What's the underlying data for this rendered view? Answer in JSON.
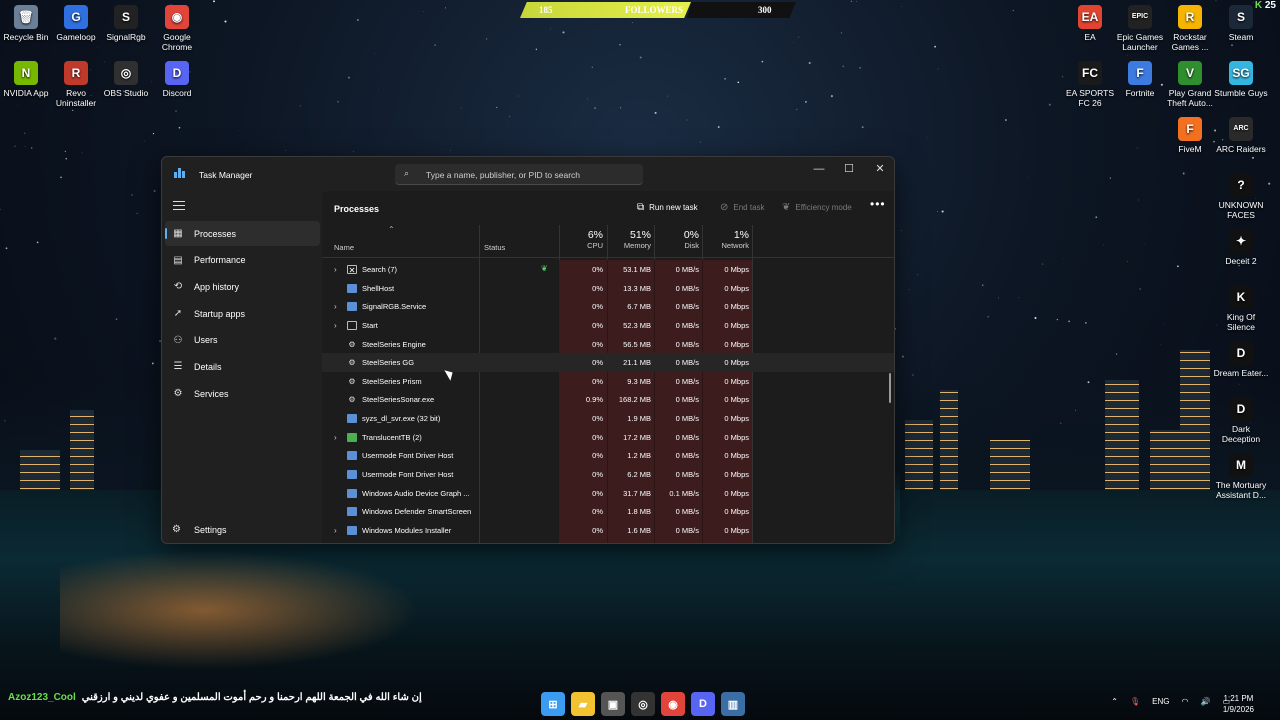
{
  "desktop": {
    "left_icons": [
      {
        "label": "Recycle Bin",
        "icon": "recycle-bin-icon",
        "color": "#6b7f96",
        "glyph": "🗑"
      },
      {
        "label": "Gameloop",
        "icon": "gameloop-icon",
        "color": "#2f6fe0",
        "glyph": "G"
      },
      {
        "label": "SignalRgb",
        "icon": "signalrgb-icon",
        "color": "#222222",
        "glyph": "S"
      },
      {
        "label": "Google Chrome",
        "icon": "chrome-icon",
        "color": "#e0443a",
        "glyph": "◉"
      },
      {
        "label": "NVIDIA App",
        "icon": "nvidia-icon",
        "color": "#76b900",
        "glyph": "N"
      },
      {
        "label": "Revo Uninstaller",
        "icon": "revo-icon",
        "color": "#c0392b",
        "glyph": "R"
      },
      {
        "label": "OBS Studio",
        "icon": "obs-icon",
        "color": "#303030",
        "glyph": "◎"
      },
      {
        "label": "Discord",
        "icon": "discord-icon",
        "color": "#5865f2",
        "glyph": "D"
      }
    ],
    "right_icons": [
      {
        "label": "EA",
        "icon": "ea-icon",
        "color": "#e2452f",
        "glyph": "EA"
      },
      {
        "label": "Epic Games Launcher",
        "icon": "epic-icon",
        "color": "#222222",
        "glyph": "EPIC"
      },
      {
        "label": "Rockstar Games ...",
        "icon": "rockstar-icon",
        "color": "#f5b400",
        "glyph": "R"
      },
      {
        "label": "Steam",
        "icon": "steam-icon",
        "color": "#1b2838",
        "glyph": "S"
      },
      {
        "label": "EA SPORTS FC 26",
        "icon": "fc26-icon",
        "color": "#1a1a1a",
        "glyph": "FC"
      },
      {
        "label": "Fortnite",
        "icon": "fortnite-icon",
        "color": "#3d7be0",
        "glyph": "F"
      },
      {
        "label": "Play Grand Theft Auto...",
        "icon": "gta-icon",
        "color": "#2f8f2f",
        "glyph": "V"
      },
      {
        "label": "Stumble Guys",
        "icon": "stumble-icon",
        "color": "#35b6e0",
        "glyph": "SG"
      },
      {
        "label": "FiveM",
        "icon": "fivem-icon",
        "color": "#f37021",
        "glyph": "F"
      },
      {
        "label": "ARC Raiders",
        "icon": "arc-raiders-icon",
        "color": "#2a2a2a",
        "glyph": "ARC"
      },
      {
        "label": "UNKNOWN FACES",
        "icon": "unknown-faces-icon",
        "color": "#111111",
        "glyph": "?"
      },
      {
        "label": "Deceit 2",
        "icon": "deceit-icon",
        "color": "#111111",
        "glyph": "✦"
      },
      {
        "label": "King Of Silence",
        "icon": "king-of-silence-icon",
        "color": "#111111",
        "glyph": "K"
      },
      {
        "label": "Dream Eater...",
        "icon": "dream-eater-icon",
        "color": "#111111",
        "glyph": "D"
      },
      {
        "label": "Dark Deception",
        "icon": "dark-deception-icon",
        "color": "#111111",
        "glyph": "D"
      },
      {
        "label": "The Mortuary Assistant D...",
        "icon": "mortuary-icon",
        "color": "#111111",
        "glyph": "M"
      }
    ],
    "followers": {
      "current": "185",
      "label": "FOLLOWERS",
      "goal": "300",
      "progress_fraction": 0.62
    },
    "corner_badge": "25"
  },
  "task_manager": {
    "title": "Task Manager",
    "search_placeholder": "Type a name, publisher, or PID to search",
    "window_buttons": {
      "minimize": "—",
      "maximize": "☐",
      "close": "✕"
    },
    "nav": [
      {
        "label": "Processes",
        "icon": "processes-icon",
        "glyph": "▦",
        "active": true
      },
      {
        "label": "Performance",
        "icon": "performance-icon",
        "glyph": "▤"
      },
      {
        "label": "App history",
        "icon": "app-history-icon",
        "glyph": "⟲"
      },
      {
        "label": "Startup apps",
        "icon": "startup-apps-icon",
        "glyph": "➚"
      },
      {
        "label": "Users",
        "icon": "users-icon",
        "glyph": "⚇"
      },
      {
        "label": "Details",
        "icon": "details-icon",
        "glyph": "☰"
      },
      {
        "label": "Services",
        "icon": "services-icon",
        "glyph": "⚙"
      }
    ],
    "settings_label": "Settings",
    "page_title": "Processes",
    "commands": {
      "run_new_task": "Run new task",
      "end_task": "End task",
      "efficiency_mode": "Efficiency mode",
      "more": "•••"
    },
    "columns": {
      "name": "Name",
      "status": "Status",
      "cpu": {
        "pct": "6%",
        "label": "CPU"
      },
      "memory": {
        "pct": "51%",
        "label": "Memory"
      },
      "disk": {
        "pct": "0%",
        "label": "Disk"
      },
      "network": {
        "pct": "1%",
        "label": "Network"
      }
    },
    "processes": [
      {
        "name": "Search (7)",
        "expandable": true,
        "icon": "search-process-icon",
        "status_icon": true,
        "cpu": "0%",
        "memory": "53.1 MB",
        "disk": "0 MB/s",
        "network": "0 Mbps"
      },
      {
        "name": "ShellHost",
        "expandable": false,
        "icon": "app-window-icon",
        "cpu": "0%",
        "memory": "13.3 MB",
        "disk": "0 MB/s",
        "network": "0 Mbps"
      },
      {
        "name": "SignalRGB.Service",
        "expandable": true,
        "icon": "app-window-icon",
        "cpu": "0%",
        "memory": "6.7 MB",
        "disk": "0 MB/s",
        "network": "0 Mbps"
      },
      {
        "name": "Start",
        "expandable": true,
        "icon": "start-process-icon",
        "cpu": "0%",
        "memory": "52.3 MB",
        "disk": "0 MB/s",
        "network": "0 Mbps"
      },
      {
        "name": "SteelSeries Engine",
        "expandable": false,
        "icon": "steelseries-icon",
        "cpu": "0%",
        "memory": "56.5 MB",
        "disk": "0 MB/s",
        "network": "0 Mbps"
      },
      {
        "name": "SteelSeries GG",
        "expandable": false,
        "icon": "steelseries-icon",
        "cpu": "0%",
        "memory": "21.1 MB",
        "disk": "0 MB/s",
        "network": "0 Mbps",
        "hover": true
      },
      {
        "name": "SteelSeries Prism",
        "expandable": false,
        "icon": "steelseries-icon",
        "cpu": "0%",
        "memory": "9.3 MB",
        "disk": "0 MB/s",
        "network": "0 Mbps"
      },
      {
        "name": "SteelSeriesSonar.exe",
        "expandable": false,
        "icon": "steelseries-icon",
        "cpu": "0.9%",
        "memory": "168.2 MB",
        "disk": "0 MB/s",
        "network": "0 Mbps"
      },
      {
        "name": "syzs_dl_svr.exe (32 bit)",
        "expandable": false,
        "icon": "app-window-icon",
        "cpu": "0%",
        "memory": "1.9 MB",
        "disk": "0 MB/s",
        "network": "0 Mbps"
      },
      {
        "name": "TranslucentTB (2)",
        "expandable": true,
        "icon": "translucenttb-icon",
        "cpu": "0%",
        "memory": "17.2 MB",
        "disk": "0 MB/s",
        "network": "0 Mbps"
      },
      {
        "name": "Usermode Font Driver Host",
        "expandable": false,
        "icon": "app-window-icon",
        "cpu": "0%",
        "memory": "1.2 MB",
        "disk": "0 MB/s",
        "network": "0 Mbps"
      },
      {
        "name": "Usermode Font Driver Host",
        "expandable": false,
        "icon": "app-window-icon",
        "cpu": "0%",
        "memory": "6.2 MB",
        "disk": "0 MB/s",
        "network": "0 Mbps"
      },
      {
        "name": "Windows Audio Device Graph ...",
        "expandable": false,
        "icon": "app-window-icon",
        "cpu": "0%",
        "memory": "31.7 MB",
        "disk": "0.1 MB/s",
        "network": "0 Mbps"
      },
      {
        "name": "Windows Defender SmartScreen",
        "expandable": false,
        "icon": "app-window-icon",
        "cpu": "0%",
        "memory": "1.8 MB",
        "disk": "0 MB/s",
        "network": "0 Mbps"
      },
      {
        "name": "Windows Modules Installer",
        "expandable": true,
        "icon": "app-window-icon",
        "cpu": "0%",
        "memory": "1.6 MB",
        "disk": "0 MB/s",
        "network": "0 Mbps"
      }
    ]
  },
  "taskbar": {
    "ticker_user": "Azoz123_Cool",
    "ticker_message": "إن شاء الله في الجمعة اللهم ارحمنا و رحم أموت المسلمين و عفوي لديني و ارزقني",
    "apps": [
      {
        "icon": "windows-start-icon",
        "color": "#3a9bf0",
        "glyph": "⊞"
      },
      {
        "icon": "file-explorer-icon",
        "color": "#f2c230",
        "glyph": "▰"
      },
      {
        "icon": "microsoft-store-icon",
        "color": "#555555",
        "glyph": "▣"
      },
      {
        "icon": "obs-taskbar-icon",
        "color": "#333333",
        "glyph": "◎"
      },
      {
        "icon": "chrome-taskbar-icon",
        "color": "#e0443a",
        "glyph": "◉"
      },
      {
        "icon": "discord-taskbar-icon",
        "color": "#5865f2",
        "glyph": "D"
      },
      {
        "icon": "task-manager-taskbar-icon",
        "color": "#3a6ea5",
        "glyph": "▥"
      }
    ],
    "language": "ENG",
    "time": "1:21 PM",
    "date": "1/9/2026"
  }
}
